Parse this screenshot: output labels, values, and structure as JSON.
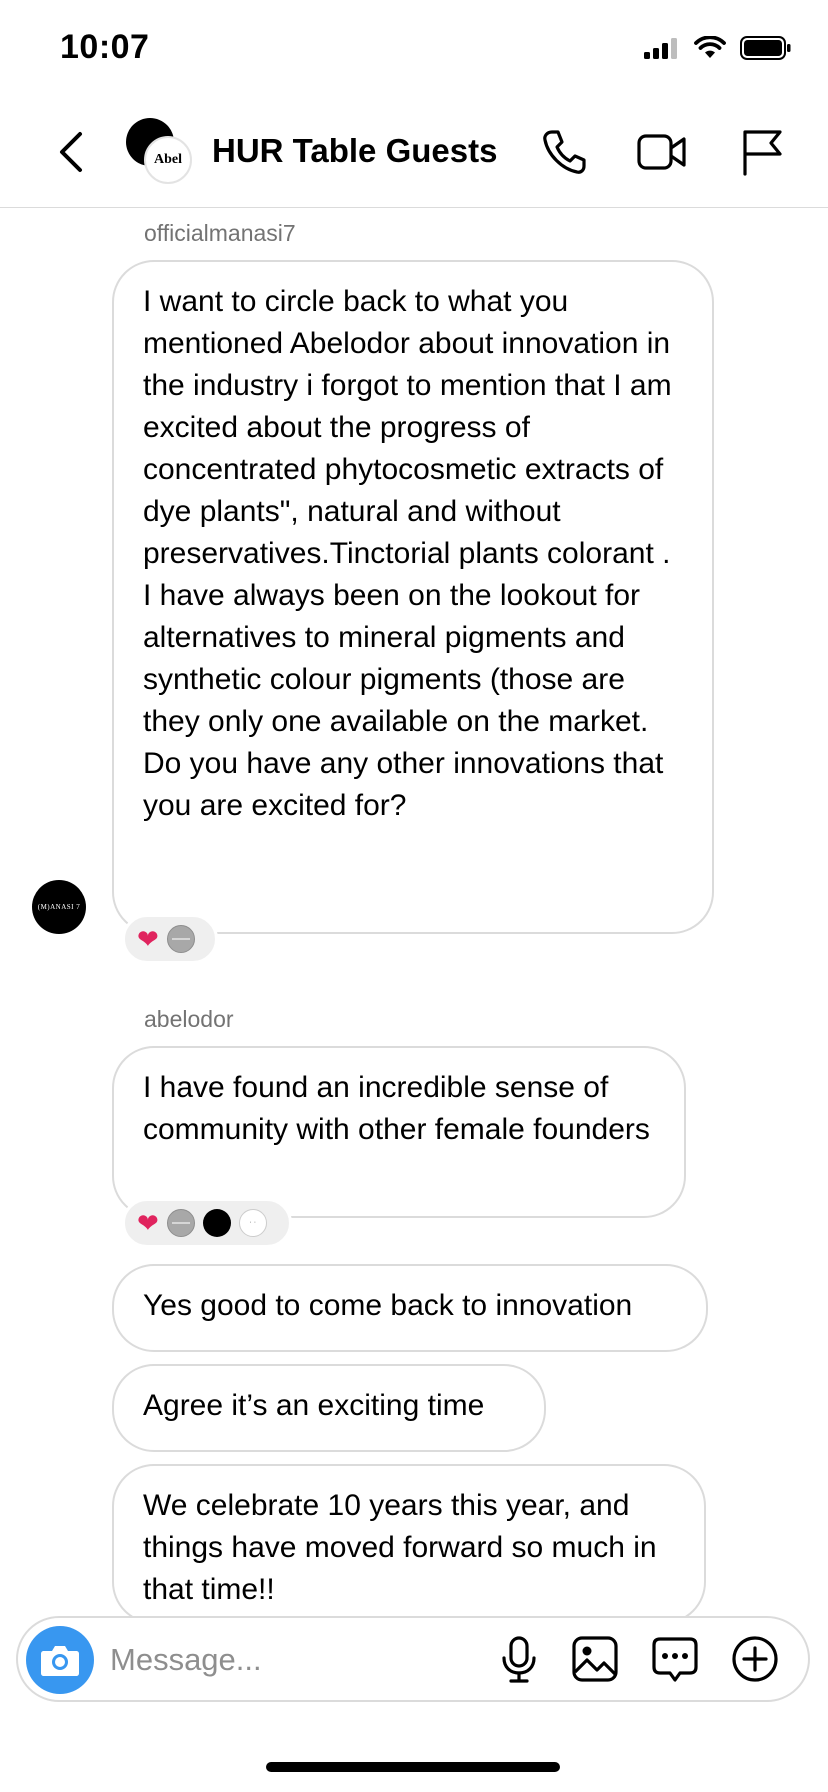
{
  "status_bar": {
    "time": "10:07"
  },
  "header": {
    "title": "HUR Table Guests",
    "avatar_label": "Abel"
  },
  "messages": [
    {
      "sender": "officialmanasi7",
      "avatar_label": "(M)ANASI 7",
      "text": "I want to circle back to what you mentioned Abelodor about innovation in the industry i forgot to mention that I am excited about the progress of concentrated phytocosmetic extracts of dye plants\", natural and without preservatives.Tinctorial plants colorant . I have always been on the lookout for alternatives to mineral pigments and synthetic colour pigments (those are they only one available on the market. Do you have any other innovations that you are excited for?",
      "reactions": [
        "heart",
        "grey-avatar"
      ]
    },
    {
      "sender": "abelodor",
      "bubbles": [
        "I have found an incredible sense of community with other female founders",
        "Yes good to come back to innovation",
        "Agree it’s an exciting time",
        "We celebrate 10 years this year, and things have moved forward so much in that time!!"
      ],
      "reactions": [
        "heart",
        "grey-avatar",
        "black-avatar",
        "white-avatar"
      ]
    }
  ],
  "composer": {
    "placeholder": "Message..."
  },
  "colors": {
    "accent": "#3897f0",
    "border": "#dbdbdb",
    "reaction_bg": "#efefef",
    "heart": "#e0245e"
  },
  "icons": [
    "back-chevron-icon",
    "phone-icon",
    "video-icon",
    "flag-icon",
    "camera-icon",
    "microphone-icon",
    "gallery-icon",
    "sticker-icon",
    "plus-icon"
  ]
}
